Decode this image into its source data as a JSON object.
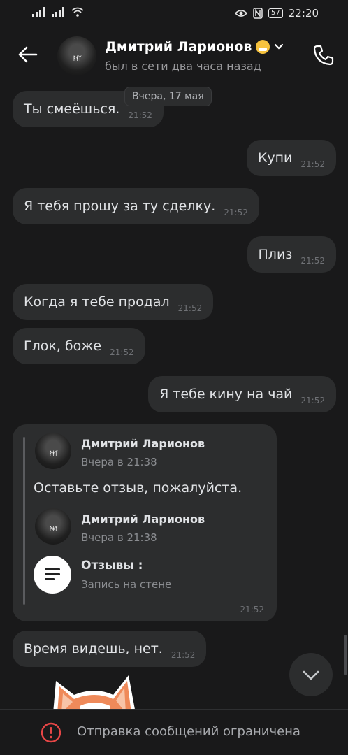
{
  "status_bar": {
    "time": "22:20",
    "battery": "57",
    "icons": [
      "signal-icon",
      "signal-icon",
      "wifi-icon",
      "eye-icon",
      "nfc-icon",
      "battery-icon"
    ]
  },
  "header": {
    "name": "Дмитрий Ларионов",
    "status": "был в сети два часа назад",
    "emoji": "face-with-mask-emoji"
  },
  "date_separator": "Вчера, 17 мая",
  "messages": [
    {
      "text": "Ты смеёшься.",
      "time": "21:52",
      "side": "in"
    },
    {
      "text": "Купи",
      "time": "21:52",
      "side": "out"
    },
    {
      "text": "Я тебя прошу за ту сделку.",
      "time": "21:52",
      "side": "in"
    },
    {
      "text": "Плиз",
      "time": "21:52",
      "side": "out"
    },
    {
      "text": "Когда я тебе продал",
      "time": "21:52",
      "side": "in"
    },
    {
      "text": "Глок, боже",
      "time": "21:52",
      "side": "in"
    },
    {
      "text": "Я тебе кину на чай",
      "time": "21:52",
      "side": "out"
    },
    {
      "text": "Время видешь, нет.",
      "time": "21:52",
      "side": "in"
    }
  ],
  "forwarded": {
    "author": "Дмитрий Ларионов",
    "author_time": "Вчера в 21:38",
    "text": "Оставьте отзыв, пожалуйста.",
    "inner_author": "Дмитрий Ларионов",
    "inner_time": "Вчера в 21:38",
    "attachment_title": "Отзывы :",
    "attachment_subtitle": "Запись на стене",
    "time": "21:52"
  },
  "bottom_notice": "Отправка сообщений ограничена",
  "colors": {
    "background": "#19191a",
    "bubble": "#2c2d2e",
    "text": "#e1e3e6",
    "secondary": "#9a9a9d",
    "warning": "#e64646"
  }
}
